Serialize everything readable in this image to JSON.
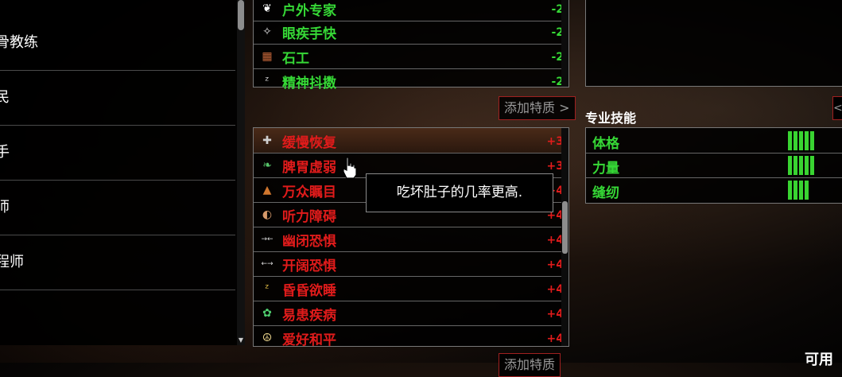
{
  "occupations": [
    {
      "label": "骨教练"
    },
    {
      "label": "民"
    },
    {
      "label": "手"
    },
    {
      "label": "师"
    },
    {
      "label": "程师"
    }
  ],
  "positive_traits": [
    {
      "icon": "leaf-icon",
      "glyph": "❦",
      "color": "#2fb82f",
      "name": "户外专家",
      "value": "-2"
    },
    {
      "icon": "swift-hand-icon",
      "glyph": "✧",
      "color": "#dddddd",
      "name": "眼疾手快",
      "value": "-2"
    },
    {
      "icon": "brick-wall-icon",
      "glyph": "▦",
      "color": "#c8683a",
      "name": "石工",
      "value": "-2"
    },
    {
      "icon": "sleep-z-icon",
      "glyph": "ᶻ",
      "color": "#dddddd",
      "name": "精神抖擞",
      "value": "-2"
    }
  ],
  "negative_traits": [
    {
      "icon": "bandage-icon",
      "glyph": "✚",
      "color": "#cfcfcf",
      "name": "缓慢恢复",
      "value": "+3"
    },
    {
      "icon": "stomach-icon",
      "glyph": "❧",
      "color": "#56c46a",
      "name": "脾胃虚弱",
      "value": "+3"
    },
    {
      "icon": "top-hat-icon",
      "glyph": "▲",
      "color": "#d0762e",
      "name": "万众瞩目",
      "value": "+4"
    },
    {
      "icon": "ear-icon",
      "glyph": "◐",
      "color": "#d79a6b",
      "name": "听力障碍",
      "value": "+4"
    },
    {
      "icon": "arrows-in-icon",
      "glyph": "→←",
      "color": "#dddddd",
      "name": "幽闭恐惧",
      "value": "+4"
    },
    {
      "icon": "arrows-out-icon",
      "glyph": "←→",
      "color": "#dddddd",
      "name": "开阔恐惧",
      "value": "+4"
    },
    {
      "icon": "drowsy-icon",
      "glyph": "ᶻ",
      "color": "#f0c94a",
      "name": "昏昏欲睡",
      "value": "+4"
    },
    {
      "icon": "germ-icon",
      "glyph": "✿",
      "color": "#4fcf6f",
      "name": "易患疾病",
      "value": "+4"
    },
    {
      "icon": "peace-icon",
      "glyph": "☮",
      "color": "#e8d28a",
      "name": "爱好和平",
      "value": "+4"
    }
  ],
  "add_trait_label": "添加特质 >",
  "add_trait_label_bottom": "添加特质",
  "tooltip_text": "吃坏肚子的几率更高.",
  "skills_title": "专业技能",
  "skills": [
    {
      "name": "体格",
      "level": 5
    },
    {
      "name": "力量",
      "level": 5
    },
    {
      "name": "缝纫",
      "level": 4
    }
  ],
  "available_label": "可用",
  "right_arrow": "<"
}
